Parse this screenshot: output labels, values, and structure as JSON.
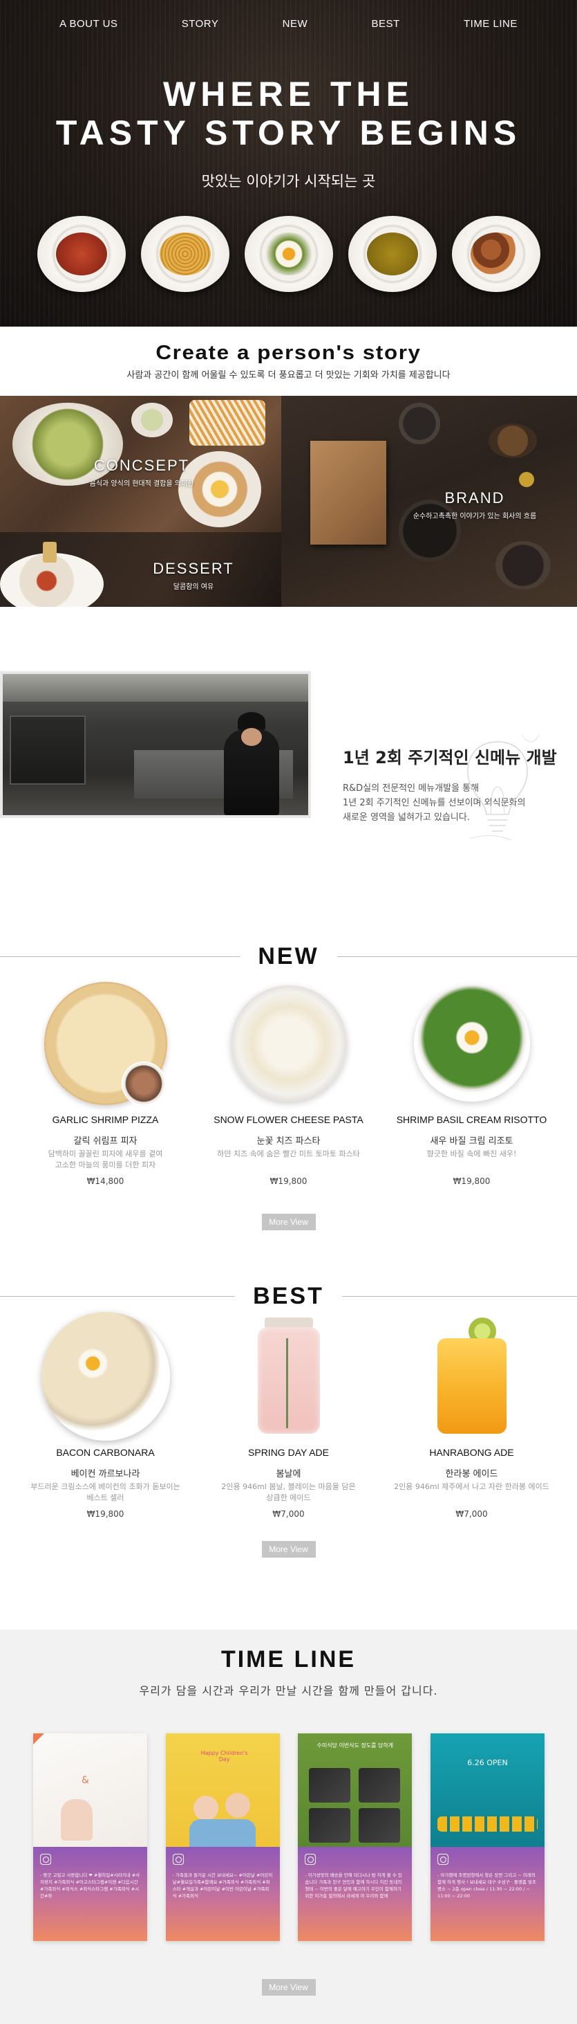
{
  "nav": {
    "items": [
      "A BOUT US",
      "STORY",
      "NEW",
      "BEST",
      "TIME LINE"
    ]
  },
  "hero": {
    "title_line1": "WHERE THE",
    "title_line2": "TASTY STORY BEGINS",
    "subtitle": "맛있는 이야기가 시작되는 곳"
  },
  "create": {
    "title": "Create a person's story",
    "subtitle": "사람과 공간이 함께 어울릴 수 있도록 더 풍요롭고 더 맛있는 기회와 가치를 제공합니다"
  },
  "mosaic": {
    "concept": {
      "title": "CONCSEPT",
      "desc": "음식과 양식의 현대적 결합을 의미한"
    },
    "brand": {
      "title": "BRAND",
      "desc": "순수하고촉촉한 이야기가 있는 회사의 흐름"
    },
    "dessert": {
      "title": "DESSERT",
      "desc": "달콤함의 여유"
    }
  },
  "chef": {
    "title": "1년 2회 주기적인 신메뉴 개발",
    "lines": [
      "R&D실의 전문적인 메뉴개발을 통해",
      "1년 2회 주기적인 신메뉴를 선보이며 외식문화의",
      "새로운 영역을 넓혀가고 있습니다."
    ]
  },
  "new_section": {
    "title": "NEW",
    "more": "More View",
    "products": [
      {
        "name": "GARLIC SHRIMP PIZZA",
        "kname": "갈릭 쉬림프 피자",
        "desc1": "담백하미 꼴꼴린 피자에 새우를 곁여",
        "desc2": "고소한 마늘의 풍미를 더한 피자",
        "price": "₩14,800"
      },
      {
        "name": "SNOW FLOWER CHEESE PASTA",
        "kname": "눈꽃 치즈 파스타",
        "desc1": "하얀 치즈 속에 숨은 빨간 미트 토마토 파스타",
        "desc2": "",
        "price": "₩19,800"
      },
      {
        "name": "SHRIMP BASIL CREAM RISOTTO",
        "kname": "새우 바질 크림 리조토",
        "desc1": "향긋한 바질 속에 빠진 새우!",
        "desc2": "",
        "price": "₩19,800"
      }
    ]
  },
  "best_section": {
    "title": "BEST",
    "more": "More View",
    "products": [
      {
        "name": "BACON CARBONARA",
        "kname": "베이컨 까르보나라",
        "desc1": "부드러운 크림소스에 베이컨의 조화가 돋보이는",
        "desc2": "베스트 셀러",
        "price": "₩19,800"
      },
      {
        "name": "SPRING DAY ADE",
        "kname": "봄날에",
        "desc1": "2인용 946ml 봄날, 블레이는 마음을 담은",
        "desc2": "상큼한 에이드",
        "price": "₩7,000"
      },
      {
        "name": "HANRABONG ADE",
        "kname": "한라봉 에이드",
        "desc1": "2인용 946ml 제주에서 나고 자란 한라봉 에이드",
        "desc2": "",
        "price": "₩7,000"
      }
    ]
  },
  "timeline": {
    "title": "TIME LINE",
    "subtitle": "우리가 담을 시간과 우리가 만날 시간을 함께 만들어 갑니다.",
    "more": "More View",
    "cards": [
      {
        "photo_text": "&",
        "caption": "- 짱굿 고릴고 사랑합니다 ❤ #월하일#사라지내 #사자랑지 #가족외식 #어고스타그램#이젠 #다음시간#가족외식 #외식스 #외식스타그램 #가족외식 #시간#와"
      },
      {
        "photo_text": "Happy Children's Day",
        "caption": "- 가족들과 즐거운 시간 보내세요~ #어린날 #어린이날#월요일가족#함께요 #가족외식 #가족외식 #파스타 #게살과 #어린이날 #이번 어린이날 #가족외식 #가족외식"
      },
      {
        "photo_text": "수미식당 이번식도 정도를 담하게",
        "caption": "- 이가성맛의 배송을 만해 되다시나 밤 하게 볼 수 있습니다 가족과 친구 연인과 함께 하시다 치킨 동네의 형태 ~ 이번의 좋은 달에 예고하기 우인이 함께하기 위한 이가출 열의에서 라세계 여 우리와 함께"
      },
      {
        "photo_text": "6.26 OPEN",
        "caption": "- 아가팬에 조명원형에서 찾은 장면 그리고 ~ 미래의 함께 하게 행사 ! 보내세요 대구 수성구 · 플랫폼 빛조명소 ~ 2층 open close / 11:30 ~ 22:00 / ~ 11:00 ~ 22:00"
      }
    ]
  },
  "colors": {
    "hero_bg": "#241d19",
    "accent_purple": "#8f58b8",
    "accent_orange": "#ef8a62",
    "button_gray": "#c5c5c5"
  }
}
